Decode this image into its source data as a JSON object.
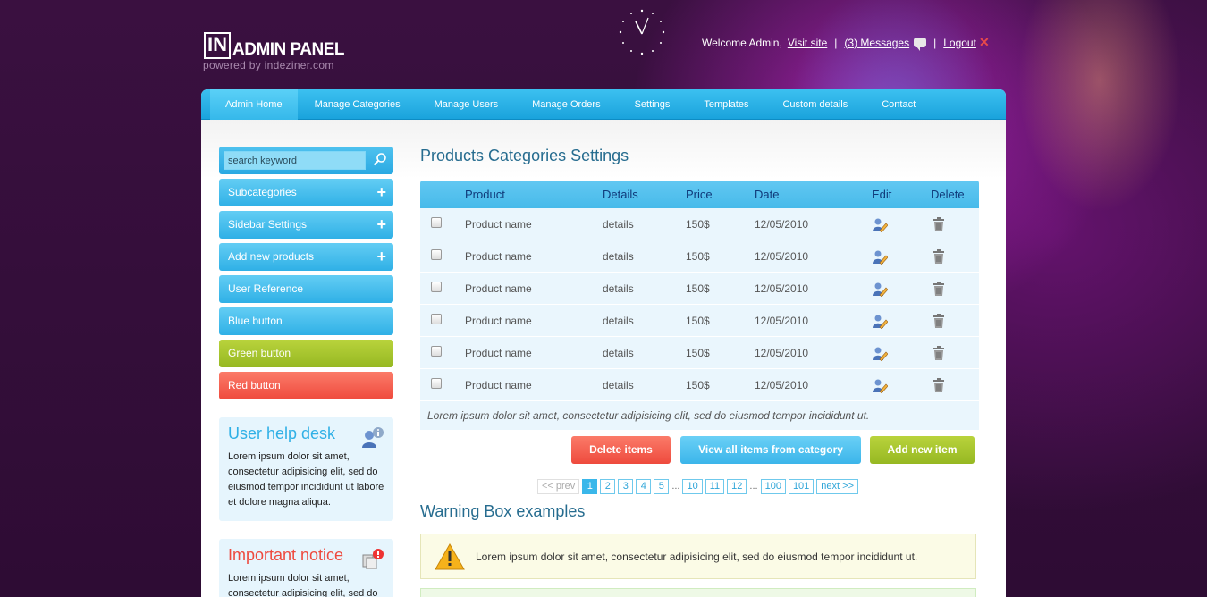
{
  "header": {
    "logo_mark": "IN",
    "logo_text": "ADMIN PANEL",
    "logo_sub": "powered by indeziner.com",
    "welcome": "Welcome Admin,",
    "visit_site": "Visit site",
    "messages": "(3) Messages",
    "logout": "Logout",
    "separator": "|"
  },
  "menu": [
    {
      "label": "Admin Home",
      "active": true
    },
    {
      "label": "Manage Categories"
    },
    {
      "label": "Manage Users"
    },
    {
      "label": "Manage Orders"
    },
    {
      "label": "Settings"
    },
    {
      "label": "Templates"
    },
    {
      "label": "Custom details"
    },
    {
      "label": "Contact"
    }
  ],
  "sidebar": {
    "search_placeholder": "search keyword",
    "buttons": [
      {
        "label": "Subcategories",
        "plus": "+"
      },
      {
        "label": "Sidebar Settings",
        "plus": "+"
      },
      {
        "label": "Add new products",
        "plus": "+"
      },
      {
        "label": "User Reference"
      },
      {
        "label": "Blue button"
      },
      {
        "label": "Green button"
      },
      {
        "label": "Red button"
      }
    ],
    "help": {
      "title": "User help desk",
      "text": "Lorem ipsum dolor sit amet, consectetur adipisicing elit, sed do eiusmod tempor incididunt ut labore et dolore magna aliqua."
    },
    "notice": {
      "title": "Important notice",
      "text": "Lorem ipsum dolor sit amet, consectetur adipisicing elit, sed do"
    }
  },
  "main": {
    "title": "Products Categories Settings",
    "columns": {
      "product": "Product",
      "details": "Details",
      "price": "Price",
      "date": "Date",
      "edit": "Edit",
      "delete": "Delete"
    },
    "rows": [
      {
        "product": "Product name",
        "details": "details",
        "price": "150$",
        "date": "12/05/2010"
      },
      {
        "product": "Product name",
        "details": "details",
        "price": "150$",
        "date": "12/05/2010"
      },
      {
        "product": "Product name",
        "details": "details",
        "price": "150$",
        "date": "12/05/2010"
      },
      {
        "product": "Product name",
        "details": "details",
        "price": "150$",
        "date": "12/05/2010"
      },
      {
        "product": "Product name",
        "details": "details",
        "price": "150$",
        "date": "12/05/2010"
      },
      {
        "product": "Product name",
        "details": "details",
        "price": "150$",
        "date": "12/05/2010"
      }
    ],
    "table_note": "Lorem ipsum dolor sit amet, consectetur adipisicing elit, sed do eiusmod tempor incididunt ut.",
    "actions": {
      "delete": "Delete items",
      "view_all": "View all items from category",
      "add_new": "Add new item"
    },
    "pagination": {
      "prev": "<< prev",
      "pages": [
        "1",
        "2",
        "3",
        "4",
        "5"
      ],
      "dots": "...",
      "pages2": [
        "10",
        "11",
        "12"
      ],
      "pages3": [
        "100",
        "101"
      ],
      "next": "next >>",
      "current": "1"
    },
    "warning_title": "Warning Box examples",
    "warning_text": "Lorem ipsum dolor sit amet, consectetur adipisicing elit, sed do eiusmod tempor incididunt ut."
  },
  "colors": {
    "accent_blue": "#2fb0e6",
    "accent_green": "#a3c22b",
    "accent_red": "#ef4a3d",
    "background": "#360f3c"
  }
}
